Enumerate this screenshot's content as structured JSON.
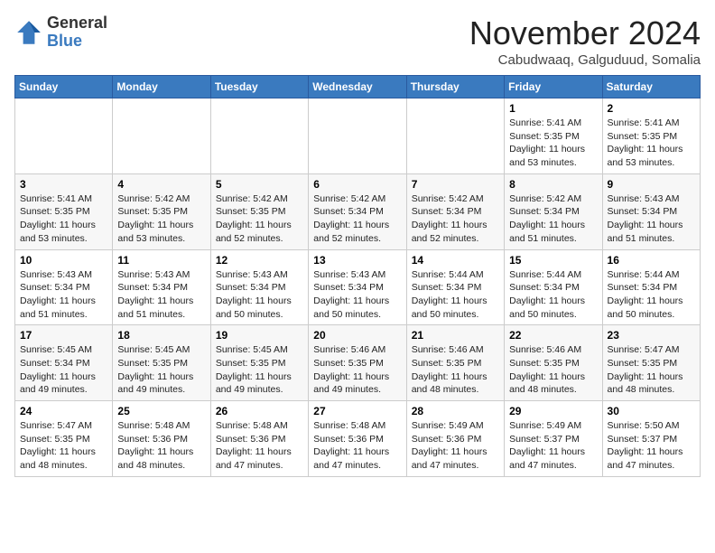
{
  "header": {
    "logo_general": "General",
    "logo_blue": "Blue",
    "month_title": "November 2024",
    "location": "Cabudwaaq, Galguduud, Somalia"
  },
  "weekdays": [
    "Sunday",
    "Monday",
    "Tuesday",
    "Wednesday",
    "Thursday",
    "Friday",
    "Saturday"
  ],
  "weeks": [
    [
      {
        "day": "",
        "info": ""
      },
      {
        "day": "",
        "info": ""
      },
      {
        "day": "",
        "info": ""
      },
      {
        "day": "",
        "info": ""
      },
      {
        "day": "",
        "info": ""
      },
      {
        "day": "1",
        "info": "Sunrise: 5:41 AM\nSunset: 5:35 PM\nDaylight: 11 hours\nand 53 minutes."
      },
      {
        "day": "2",
        "info": "Sunrise: 5:41 AM\nSunset: 5:35 PM\nDaylight: 11 hours\nand 53 minutes."
      }
    ],
    [
      {
        "day": "3",
        "info": "Sunrise: 5:41 AM\nSunset: 5:35 PM\nDaylight: 11 hours\nand 53 minutes."
      },
      {
        "day": "4",
        "info": "Sunrise: 5:42 AM\nSunset: 5:35 PM\nDaylight: 11 hours\nand 53 minutes."
      },
      {
        "day": "5",
        "info": "Sunrise: 5:42 AM\nSunset: 5:35 PM\nDaylight: 11 hours\nand 52 minutes."
      },
      {
        "day": "6",
        "info": "Sunrise: 5:42 AM\nSunset: 5:34 PM\nDaylight: 11 hours\nand 52 minutes."
      },
      {
        "day": "7",
        "info": "Sunrise: 5:42 AM\nSunset: 5:34 PM\nDaylight: 11 hours\nand 52 minutes."
      },
      {
        "day": "8",
        "info": "Sunrise: 5:42 AM\nSunset: 5:34 PM\nDaylight: 11 hours\nand 51 minutes."
      },
      {
        "day": "9",
        "info": "Sunrise: 5:43 AM\nSunset: 5:34 PM\nDaylight: 11 hours\nand 51 minutes."
      }
    ],
    [
      {
        "day": "10",
        "info": "Sunrise: 5:43 AM\nSunset: 5:34 PM\nDaylight: 11 hours\nand 51 minutes."
      },
      {
        "day": "11",
        "info": "Sunrise: 5:43 AM\nSunset: 5:34 PM\nDaylight: 11 hours\nand 51 minutes."
      },
      {
        "day": "12",
        "info": "Sunrise: 5:43 AM\nSunset: 5:34 PM\nDaylight: 11 hours\nand 50 minutes."
      },
      {
        "day": "13",
        "info": "Sunrise: 5:43 AM\nSunset: 5:34 PM\nDaylight: 11 hours\nand 50 minutes."
      },
      {
        "day": "14",
        "info": "Sunrise: 5:44 AM\nSunset: 5:34 PM\nDaylight: 11 hours\nand 50 minutes."
      },
      {
        "day": "15",
        "info": "Sunrise: 5:44 AM\nSunset: 5:34 PM\nDaylight: 11 hours\nand 50 minutes."
      },
      {
        "day": "16",
        "info": "Sunrise: 5:44 AM\nSunset: 5:34 PM\nDaylight: 11 hours\nand 50 minutes."
      }
    ],
    [
      {
        "day": "17",
        "info": "Sunrise: 5:45 AM\nSunset: 5:34 PM\nDaylight: 11 hours\nand 49 minutes."
      },
      {
        "day": "18",
        "info": "Sunrise: 5:45 AM\nSunset: 5:35 PM\nDaylight: 11 hours\nand 49 minutes."
      },
      {
        "day": "19",
        "info": "Sunrise: 5:45 AM\nSunset: 5:35 PM\nDaylight: 11 hours\nand 49 minutes."
      },
      {
        "day": "20",
        "info": "Sunrise: 5:46 AM\nSunset: 5:35 PM\nDaylight: 11 hours\nand 49 minutes."
      },
      {
        "day": "21",
        "info": "Sunrise: 5:46 AM\nSunset: 5:35 PM\nDaylight: 11 hours\nand 48 minutes."
      },
      {
        "day": "22",
        "info": "Sunrise: 5:46 AM\nSunset: 5:35 PM\nDaylight: 11 hours\nand 48 minutes."
      },
      {
        "day": "23",
        "info": "Sunrise: 5:47 AM\nSunset: 5:35 PM\nDaylight: 11 hours\nand 48 minutes."
      }
    ],
    [
      {
        "day": "24",
        "info": "Sunrise: 5:47 AM\nSunset: 5:35 PM\nDaylight: 11 hours\nand 48 minutes."
      },
      {
        "day": "25",
        "info": "Sunrise: 5:48 AM\nSunset: 5:36 PM\nDaylight: 11 hours\nand 48 minutes."
      },
      {
        "day": "26",
        "info": "Sunrise: 5:48 AM\nSunset: 5:36 PM\nDaylight: 11 hours\nand 47 minutes."
      },
      {
        "day": "27",
        "info": "Sunrise: 5:48 AM\nSunset: 5:36 PM\nDaylight: 11 hours\nand 47 minutes."
      },
      {
        "day": "28",
        "info": "Sunrise: 5:49 AM\nSunset: 5:36 PM\nDaylight: 11 hours\nand 47 minutes."
      },
      {
        "day": "29",
        "info": "Sunrise: 5:49 AM\nSunset: 5:37 PM\nDaylight: 11 hours\nand 47 minutes."
      },
      {
        "day": "30",
        "info": "Sunrise: 5:50 AM\nSunset: 5:37 PM\nDaylight: 11 hours\nand 47 minutes."
      }
    ]
  ]
}
